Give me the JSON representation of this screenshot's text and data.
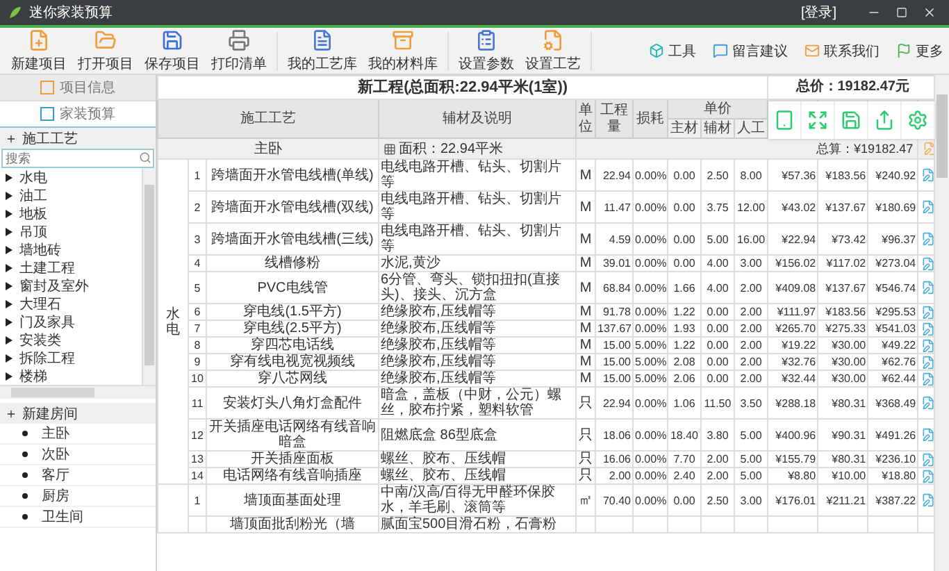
{
  "window": {
    "title": "迷你家装预算",
    "login": "[登录]"
  },
  "toolbar": {
    "buttons": [
      "新建项目",
      "打开项目",
      "保存项目",
      "打印清单",
      "我的工艺库",
      "我的材料库",
      "设置参数",
      "设置工艺"
    ],
    "links": [
      "工具",
      "留言建议",
      "联系我们",
      "更多"
    ]
  },
  "sidebar": {
    "tabs": [
      {
        "label": "项目信息",
        "selected": false
      },
      {
        "label": "家装预算",
        "selected": true
      }
    ],
    "craft_header": "施工工艺",
    "search": {
      "placeholder": "搜索"
    },
    "craft_items": [
      "水电",
      "油工",
      "地板",
      "吊顶",
      "墙地砖",
      "土建工程",
      "窗封及室外",
      "大理石",
      "门及家具",
      "安装类",
      "拆除工程",
      "楼梯"
    ],
    "room_header": "新建房间",
    "rooms": [
      "主卧",
      "次卧",
      "客厅",
      "厨房",
      "卫生间"
    ]
  },
  "project": {
    "title": "新工程(总面积:22.94平米(1室))",
    "total": "总价：19182.47元"
  },
  "columns": {
    "craft": "施工工艺",
    "desc": "辅材及说明",
    "unit": "单位",
    "qty": "工程量",
    "loss": "损耗",
    "price": "单价",
    "main": "主材",
    "aux": "辅材",
    "labor": "人工"
  },
  "room": {
    "name": "主卧",
    "area": "面积：22.94平米",
    "subtotal": "总算：¥19182.47"
  },
  "groups": [
    {
      "category": "水电",
      "rows": [
        {
          "no": "1",
          "name": "跨墙面开水管电线槽(单线)",
          "desc": "电线电路开槽、钻头、切割片等",
          "unit": "M",
          "qty": "22.94",
          "loss": "0.00%",
          "main": "0.00",
          "aux": "2.50",
          "labor": "8.00",
          "material_total": "¥57.36",
          "labor_total": "¥183.56",
          "total": "¥240.92"
        },
        {
          "no": "2",
          "name": "跨墙面开水管电线槽(双线)",
          "desc": "电线电路开槽、钻头、切割片等",
          "unit": "M",
          "qty": "11.47",
          "loss": "0.00%",
          "main": "0.00",
          "aux": "3.75",
          "labor": "12.00",
          "material_total": "¥43.02",
          "labor_total": "¥137.67",
          "total": "¥180.69"
        },
        {
          "no": "3",
          "name": "跨墙面开水管电线槽(三线)",
          "desc": "电线电路开槽、钻头、切割片等",
          "unit": "M",
          "qty": "4.59",
          "loss": "0.00%",
          "main": "0.00",
          "aux": "5.00",
          "labor": "16.00",
          "material_total": "¥22.94",
          "labor_total": "¥73.42",
          "total": "¥96.37"
        },
        {
          "no": "4",
          "name": "线槽修粉",
          "desc": "水泥,黄沙",
          "unit": "M",
          "qty": "39.01",
          "loss": "0.00%",
          "main": "0.00",
          "aux": "4.00",
          "labor": "3.00",
          "material_total": "¥156.02",
          "labor_total": "¥117.02",
          "total": "¥273.04"
        },
        {
          "no": "5",
          "name": "PVC电线管",
          "desc": "6分管、弯头、锁扣扭扣(直接头)、接头、沉方盒",
          "unit": "M",
          "qty": "68.84",
          "loss": "0.00%",
          "main": "1.66",
          "aux": "4.00",
          "labor": "2.00",
          "material_total": "¥409.08",
          "labor_total": "¥137.67",
          "total": "¥546.74"
        },
        {
          "no": "6",
          "name": "穿电线(1.5平方)",
          "desc": "绝缘胶布,压线帽等",
          "unit": "M",
          "qty": "91.78",
          "loss": "0.00%",
          "main": "1.22",
          "aux": "0.00",
          "labor": "2.00",
          "material_total": "¥111.97",
          "labor_total": "¥183.56",
          "total": "¥295.53"
        },
        {
          "no": "7",
          "name": "穿电线(2.5平方)",
          "desc": "绝缘胶布,压线帽等",
          "unit": "M",
          "qty": "137.67",
          "loss": "0.00%",
          "main": "1.93",
          "aux": "0.00",
          "labor": "2.00",
          "material_total": "¥265.70",
          "labor_total": "¥275.33",
          "total": "¥541.03"
        },
        {
          "no": "8",
          "name": "穿四芯电话线",
          "desc": "绝缘胶布,压线帽等",
          "unit": "M",
          "qty": "15.00",
          "loss": "5.00%",
          "main": "1.22",
          "aux": "0.00",
          "labor": "2.00",
          "material_total": "¥19.22",
          "labor_total": "¥30.00",
          "total": "¥49.22"
        },
        {
          "no": "9",
          "name": "穿有线电视宽视频线",
          "desc": "绝缘胶布,压线帽等",
          "unit": "M",
          "qty": "15.00",
          "loss": "5.00%",
          "main": "2.08",
          "aux": "0.00",
          "labor": "2.00",
          "material_total": "¥32.76",
          "labor_total": "¥30.00",
          "total": "¥62.76"
        },
        {
          "no": "10",
          "name": "穿八芯网线",
          "desc": "绝缘胶布,压线帽等",
          "unit": "M",
          "qty": "15.00",
          "loss": "5.00%",
          "main": "2.06",
          "aux": "0.00",
          "labor": "2.00",
          "material_total": "¥32.44",
          "labor_total": "¥30.00",
          "total": "¥62.44"
        },
        {
          "no": "11",
          "name": "安装灯头八角灯盒配件",
          "desc": "暗盒，盖板（中财，公元）螺丝，胶布拧紧，塑料软管",
          "unit": "只",
          "qty": "22.94",
          "loss": "0.00%",
          "main": "1.06",
          "aux": "11.50",
          "labor": "3.50",
          "material_total": "¥288.18",
          "labor_total": "¥80.31",
          "total": "¥368.49"
        },
        {
          "no": "12",
          "name": "开关插座电话网络有线音响暗盒",
          "desc": "阻燃底盒 86型底盒",
          "unit": "只",
          "qty": "18.06",
          "loss": "0.00%",
          "main": "18.40",
          "aux": "3.80",
          "labor": "5.00",
          "material_total": "¥400.96",
          "labor_total": "¥90.31",
          "total": "¥491.26"
        },
        {
          "no": "13",
          "name": "开关插座面板",
          "desc": "螺丝、胶布、压线帽",
          "unit": "只",
          "qty": "16.06",
          "loss": "0.00%",
          "main": "7.70",
          "aux": "2.00",
          "labor": "5.00",
          "material_total": "¥155.79",
          "labor_total": "¥80.31",
          "total": "¥236.10"
        },
        {
          "no": "14",
          "name": "电话网络有线音响插座",
          "desc": "螺丝、胶布、压线帽",
          "unit": "只",
          "qty": "2.00",
          "loss": "0.00%",
          "main": "2.40",
          "aux": "2.00",
          "labor": "5.00",
          "material_total": "¥8.80",
          "labor_total": "¥10.00",
          "total": "¥18.80"
        }
      ]
    },
    {
      "rows": [
        {
          "no": "1",
          "name": "墙顶面基面处理",
          "desc": "中南/汉高/百得无甲醛环保胶水，羊毛刷、滚筒等",
          "unit": "㎡",
          "qty": "70.40",
          "loss": "0.00%",
          "main": "0.00",
          "aux": "2.50",
          "labor": "3.00",
          "material_total": "¥176.01",
          "labor_total": "¥211.21",
          "total": "¥387.22"
        },
        {
          "name": "墙顶面批刮粉光（墙",
          "desc": "腻面宝500目滑石粉，石膏粉"
        }
      ]
    }
  ]
}
